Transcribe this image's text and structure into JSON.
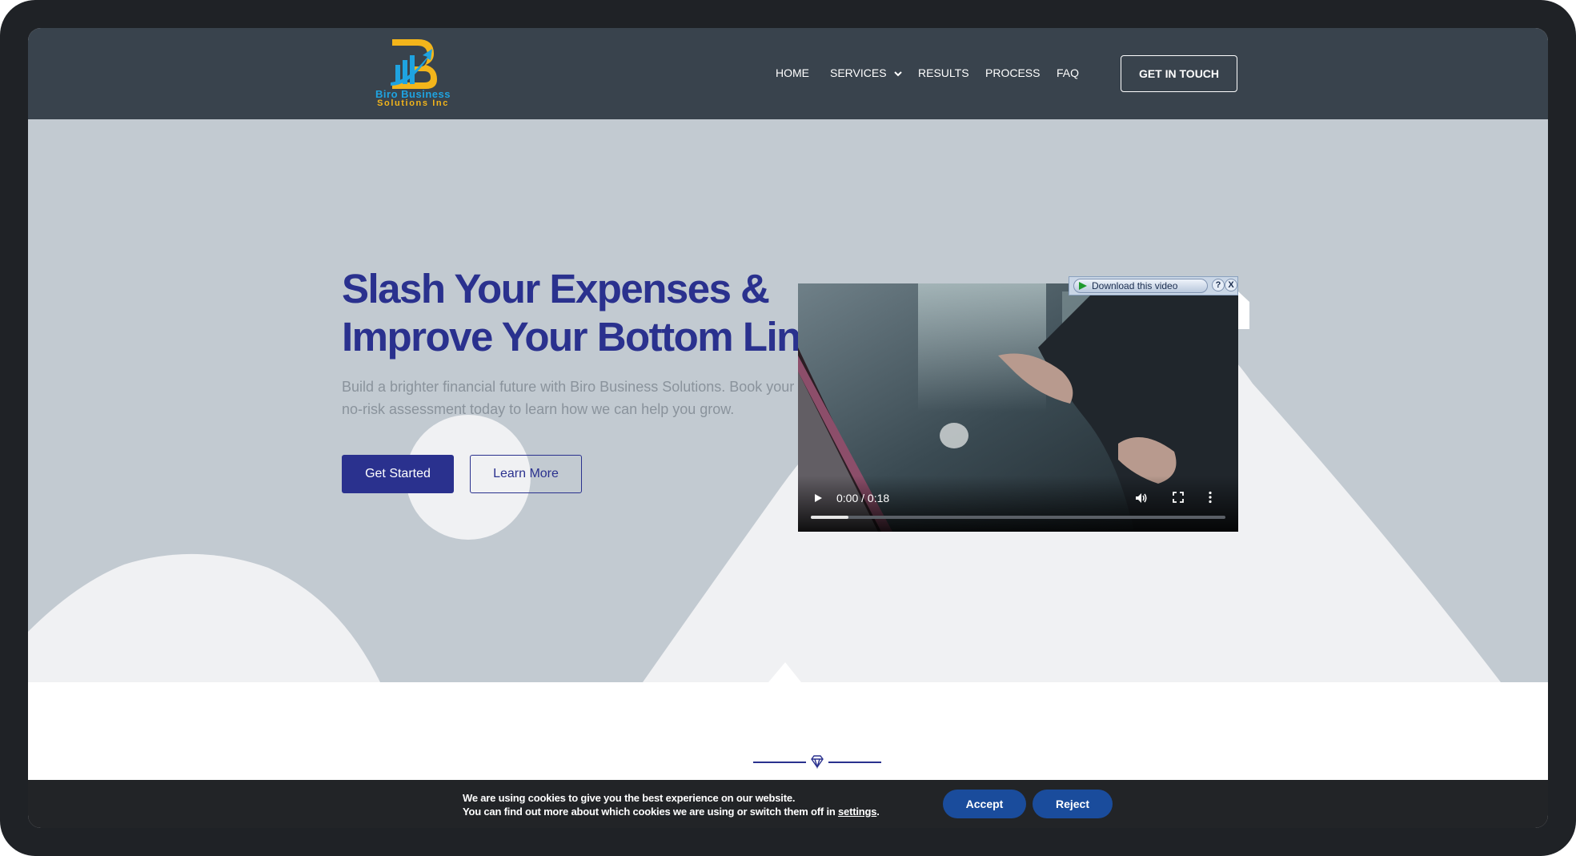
{
  "brand": {
    "name_line1": "Biro Business",
    "name_line2": "Solutions Inc",
    "colors": {
      "blue": "#1fa3e0",
      "gold": "#f3b51b",
      "navy": "#2a318e"
    }
  },
  "nav": {
    "items": [
      {
        "label": "HOME"
      },
      {
        "label": "SERVICES",
        "has_dropdown": true
      },
      {
        "label": "RESULTS"
      },
      {
        "label": "PROCESS"
      },
      {
        "label": "FAQ"
      }
    ],
    "cta_label": "GET IN TOUCH"
  },
  "hero": {
    "title_line1": "Slash Your Expenses &",
    "title_line2": "Improve Your Bottom Line",
    "description_line1": "Build a brighter financial future with Biro Business Solutions. Book your",
    "description_line2": "no-risk assessment today to learn how we can help you grow.",
    "primary_button": "Get Started",
    "secondary_button": "Learn More"
  },
  "video": {
    "time": "0:00 / 0:18",
    "progress": 0.09,
    "download_label": "Download this video",
    "help_label": "?",
    "close_label": "X"
  },
  "cookie": {
    "line1": "We are using cookies to give you the best experience on our website.",
    "line2_prefix": "You can find out more about which cookies we are using or switch them off in ",
    "line2_link": "settings",
    "line2_suffix": ".",
    "accept_label": "Accept",
    "reject_label": "Reject"
  }
}
